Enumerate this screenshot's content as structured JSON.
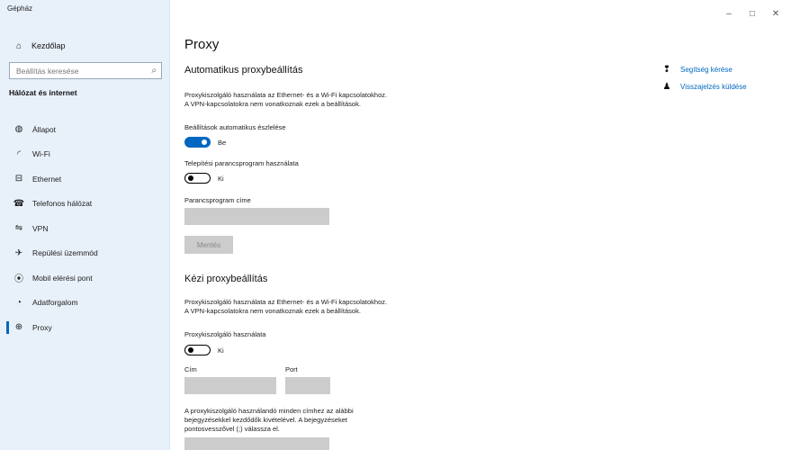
{
  "window": {
    "title": "Gépház",
    "controls": {
      "minimize": "–",
      "maximize": "□",
      "close": "✕"
    }
  },
  "sidebar": {
    "home": {
      "label": "Kezdőlap",
      "icon": "home-icon"
    },
    "search": {
      "placeholder": "Beállítás keresése",
      "icon": "search-icon"
    },
    "section_heading": "Hálózat és internet",
    "items": [
      {
        "label": "Állapot",
        "icon": "globe-status-icon"
      },
      {
        "label": "Wi-Fi",
        "icon": "wifi-icon"
      },
      {
        "label": "Ethernet",
        "icon": "ethernet-icon"
      },
      {
        "label": "Telefonos hálózat",
        "icon": "dialup-icon"
      },
      {
        "label": "VPN",
        "icon": "vpn-icon"
      },
      {
        "label": "Repülési üzemmód",
        "icon": "airplane-icon"
      },
      {
        "label": "Mobil elérési pont",
        "icon": "hotspot-icon"
      },
      {
        "label": "Adatforgalom",
        "icon": "data-usage-icon"
      },
      {
        "label": "Proxy",
        "icon": "proxy-globe-icon",
        "active": true
      }
    ],
    "accent_color": "#0067c0"
  },
  "main": {
    "title": "Proxy",
    "auto": {
      "heading": "Automatikus proxybeállítás",
      "desc_line1": "Proxykiszolgáló használata az Ethernet- és a Wi-Fi kapcsolatokhoz.",
      "desc_line2": "A VPN-kapcsolatokra nem vonatkoznak ezek a beállítások.",
      "detect_label": "Beállítások automatikus észlelése",
      "detect_state": "Be",
      "script_label": "Telepítési parancsprogram használata",
      "script_state": "Ki",
      "address_label": "Parancsprogram címe",
      "address_value": "",
      "save_label": "Mentés"
    },
    "manual": {
      "heading": "Kézi proxybeállítás",
      "desc_line1": "Proxykiszolgáló használata az Ethernet- és a Wi-Fi kapcsolatokhoz.",
      "desc_line2": "A VPN-kapcsolatokra nem vonatkoznak ezek a beállítások.",
      "use_label": "Proxykiszolgáló használata",
      "use_state": "Ki",
      "address_label": "Cím",
      "address_value": "",
      "port_label": "Port",
      "port_value": "",
      "exceptions_line1": "A proxykiszolgáló használandó minden címhez az alábbi",
      "exceptions_line2": "bejegyzésekkel kezdődők kivételével. A bejegyzéseket",
      "exceptions_line3": "pontosvesszővel (;) válassza el.",
      "exceptions_value": ""
    },
    "help": {
      "get_help": "Segítség kérése",
      "feedback": "Visszajelzés küldése"
    }
  }
}
